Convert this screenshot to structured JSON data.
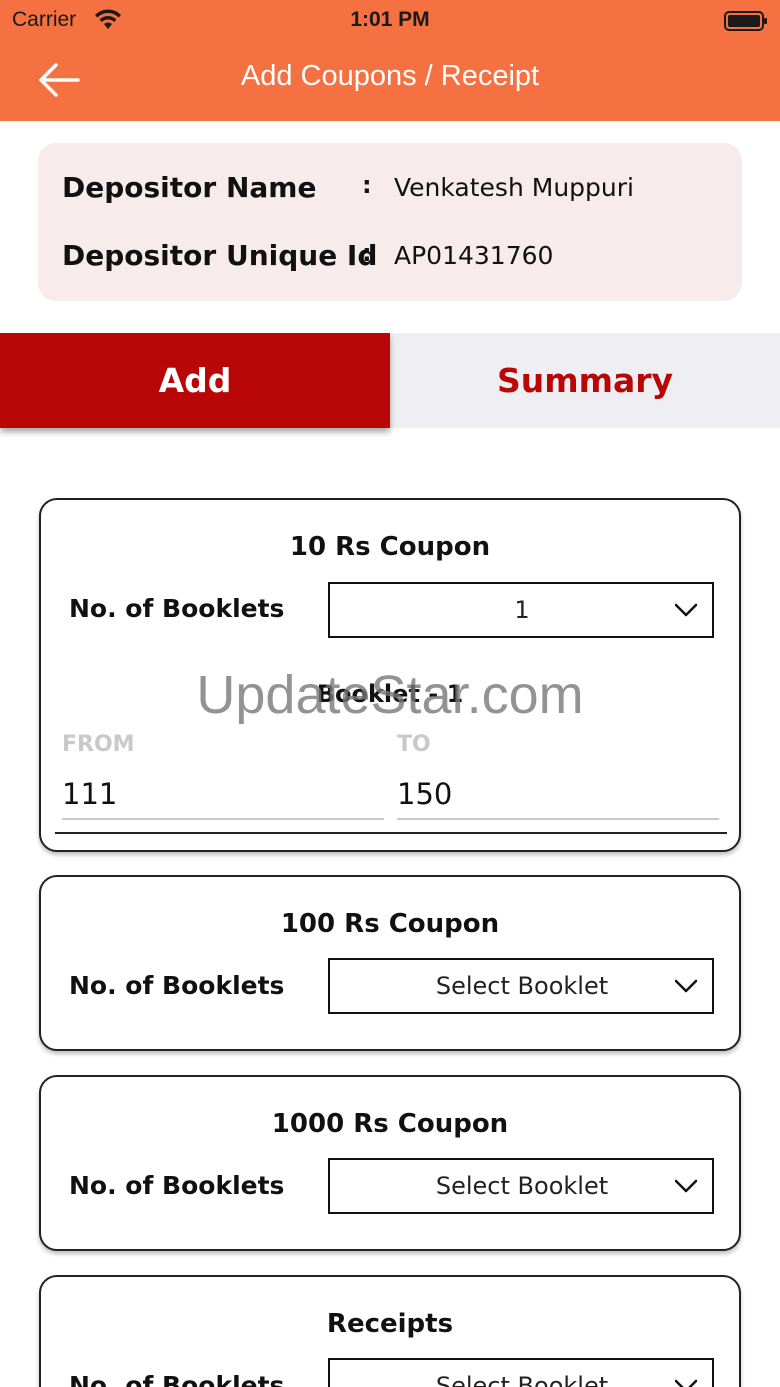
{
  "status_bar": {
    "carrier": "Carrier",
    "time": "1:01 PM"
  },
  "nav": {
    "title": "Add Coupons / Receipt",
    "back_icon": "arrow-left-icon"
  },
  "depositor": {
    "name_label": "Depositor Name",
    "name_value": "Venkatesh Muppuri",
    "id_label": "Depositor Unique Id",
    "id_value": "AP01431760",
    "colon": ":"
  },
  "tabs": {
    "add": "Add",
    "summary": "Summary"
  },
  "coupons": [
    {
      "title": "10 Rs Coupon",
      "booklets_label": "No. of Booklets",
      "selected": "1",
      "booklet_title": "Booklet - 1",
      "from_label": "FROM",
      "from_value": "111",
      "to_label": "TO",
      "to_value": "150"
    },
    {
      "title": "100 Rs Coupon",
      "booklets_label": "No. of Booklets",
      "selected": "Select Booklet"
    },
    {
      "title": "1000 Rs Coupon",
      "booklets_label": "No. of Booklets",
      "selected": "Select Booklet"
    },
    {
      "title": "Receipts",
      "booklets_label": "No. of Booklets",
      "selected": "Select Booklet"
    }
  ],
  "watermark": "UpdateStar.com",
  "colors": {
    "header": "#f57142",
    "tab_active": "#b90607",
    "depositor_bg": "#f8ebeb"
  }
}
